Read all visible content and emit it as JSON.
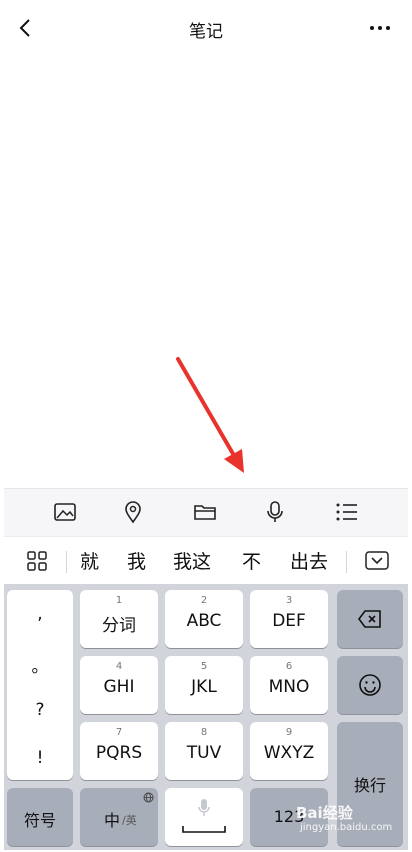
{
  "header": {
    "title": "笔记"
  },
  "candidates": [
    "就",
    "我",
    "我这",
    "不",
    "出去"
  ],
  "keyboard": {
    "punctuation": [
      ",",
      "。",
      "?",
      "!"
    ],
    "rows": [
      [
        {
          "num": "1",
          "label": "分词"
        },
        {
          "num": "2",
          "label": "ABC"
        },
        {
          "num": "3",
          "label": "DEF"
        }
      ],
      [
        {
          "num": "4",
          "label": "GHI"
        },
        {
          "num": "5",
          "label": "JKL"
        },
        {
          "num": "6",
          "label": "MNO"
        }
      ],
      [
        {
          "num": "7",
          "label": "PQRS"
        },
        {
          "num": "8",
          "label": "TUV"
        },
        {
          "num": "9",
          "label": "WXYZ"
        }
      ]
    ],
    "symbols": "符号",
    "lang_main": "中",
    "lang_sub": "/英",
    "numbers": "123",
    "enter": "换行"
  },
  "watermark": {
    "brand": "Bai经验",
    "url": "jingyan.baidu.com"
  },
  "colors": {
    "arrow": "#e8322b",
    "keyboard_bg": "#d1d4db",
    "dark_key": "#a8aeb9"
  }
}
